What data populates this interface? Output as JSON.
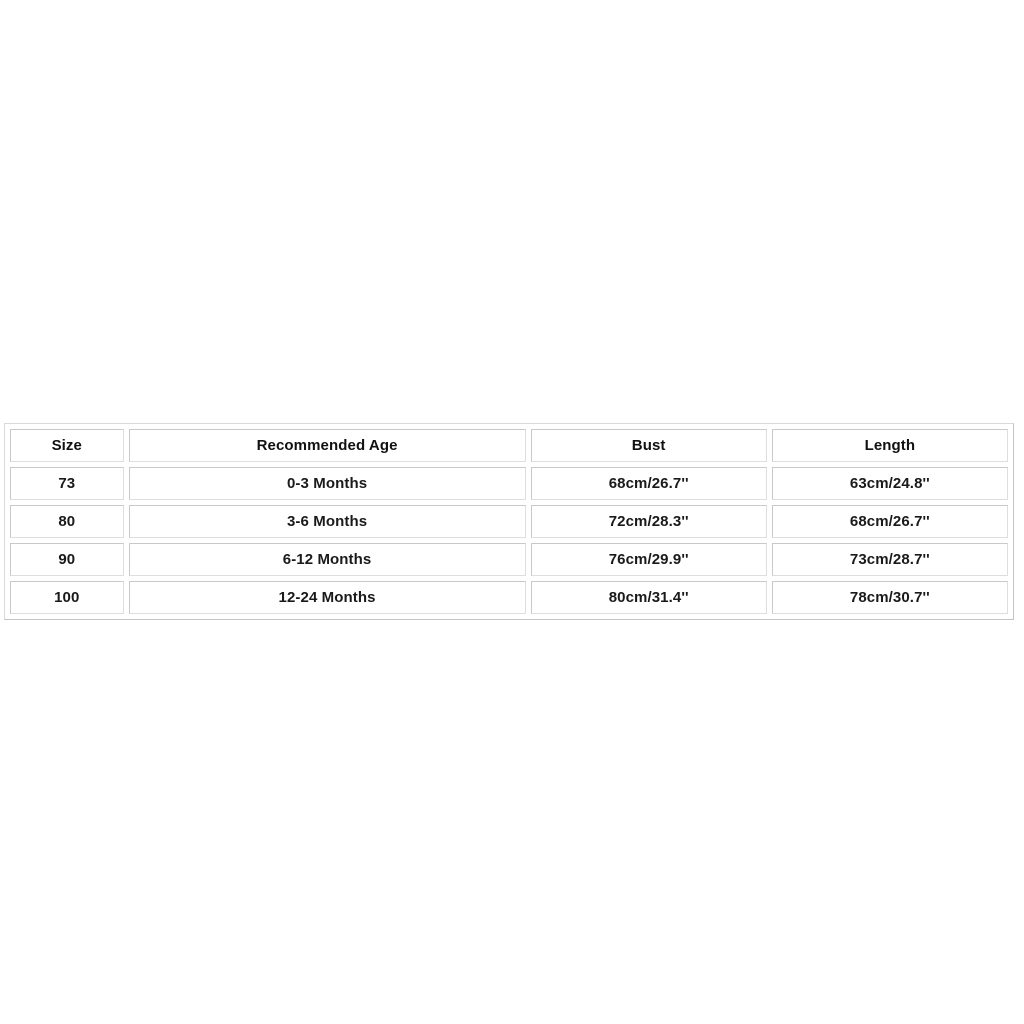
{
  "page": {
    "background_color": "#ffffff",
    "text_color": "#1a1a1a",
    "border_color": "#d2d2d2"
  },
  "size_chart": {
    "columns": [
      {
        "key": "size",
        "label": "Size"
      },
      {
        "key": "age",
        "label": "Recommended Age"
      },
      {
        "key": "bust",
        "label": "Bust"
      },
      {
        "key": "length",
        "label": "Length"
      }
    ],
    "rows": [
      {
        "size": "73",
        "age": "0-3 Months",
        "bust": "68cm/26.7''",
        "length": "63cm/24.8''"
      },
      {
        "size": "80",
        "age": "3-6 Months",
        "bust": "72cm/28.3''",
        "length": "68cm/26.7''"
      },
      {
        "size": "90",
        "age": "6-12 Months",
        "bust": "76cm/29.9''",
        "length": "73cm/28.7''"
      },
      {
        "size": "100",
        "age": "12-24 Months",
        "bust": "80cm/31.4''",
        "length": "78cm/30.7''"
      }
    ]
  }
}
